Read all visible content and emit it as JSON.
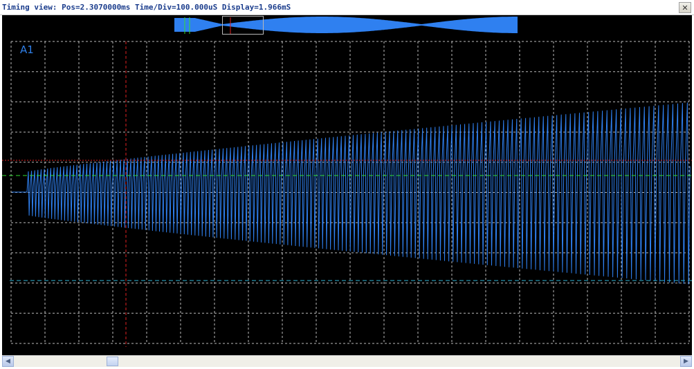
{
  "window": {
    "title": "Timing view: Pos=2.3070000ms Time/Div=100.000uS Display=1.966mS",
    "close_glyph": "✕"
  },
  "scope": {
    "channel_label": "A1",
    "background": "#000000",
    "trace_color": "#2f80f0",
    "grid_color": "#bbbbbb",
    "cursor_red_color": "#e02020",
    "cursor_green_color": "#30e030",
    "cursor_cyan_color": "#30b8d8"
  },
  "scrollbar": {
    "left_glyph": "◀",
    "right_glyph": "▶"
  }
}
